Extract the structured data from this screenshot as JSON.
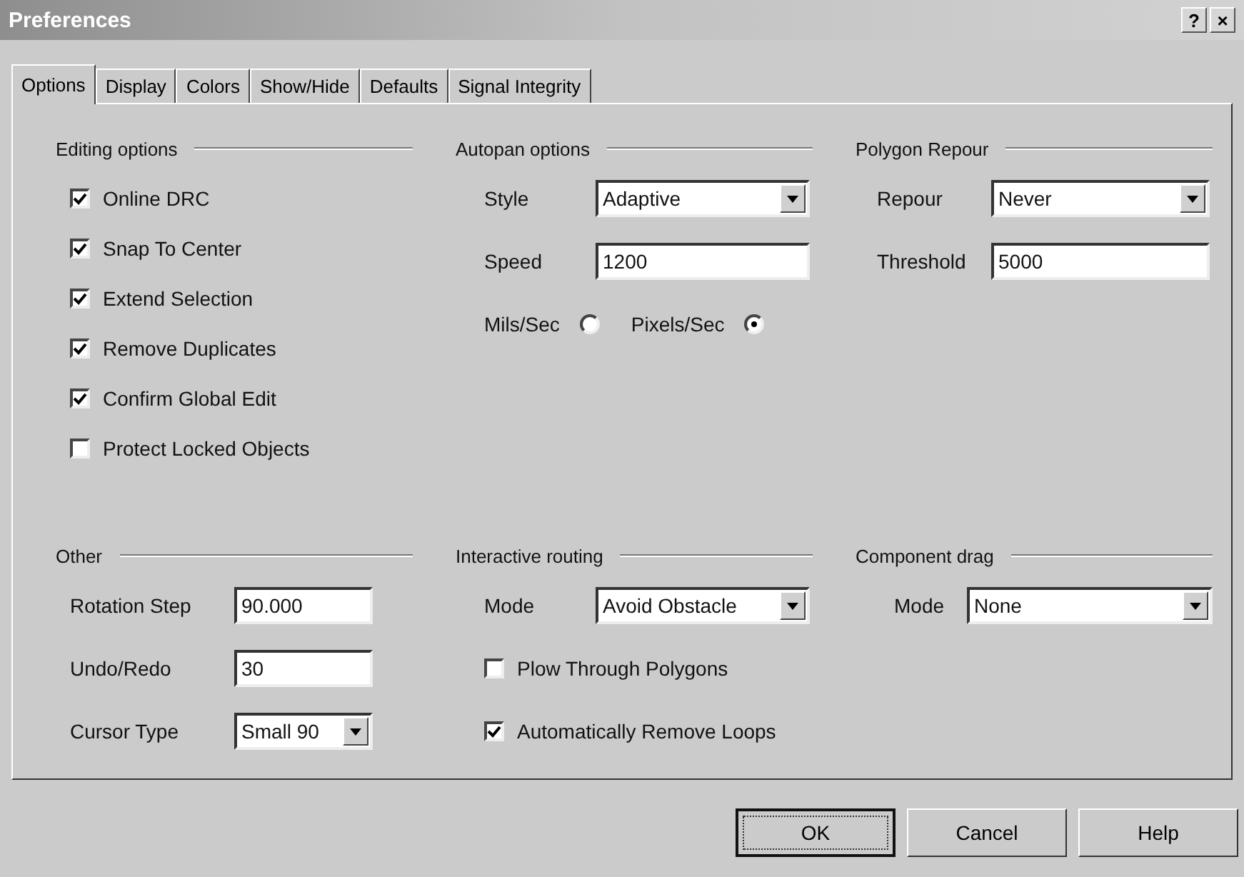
{
  "window": {
    "title": "Preferences",
    "title_buttons": [
      "?",
      "×"
    ]
  },
  "tabs": [
    {
      "label": "Options",
      "selected": true
    },
    {
      "label": "Display",
      "selected": false
    },
    {
      "label": "Colors",
      "selected": false
    },
    {
      "label": "Show/Hide",
      "selected": false
    },
    {
      "label": "Defaults",
      "selected": false
    },
    {
      "label": "Signal Integrity",
      "selected": false
    }
  ],
  "groups": [
    {
      "title": "Editing options",
      "items": [
        {
          "kind": "checkbox",
          "label": "Online DRC",
          "checked": true
        },
        {
          "kind": "checkbox",
          "label": "Snap To Center",
          "checked": true
        },
        {
          "kind": "checkbox",
          "label": "Extend Selection",
          "checked": true
        },
        {
          "kind": "checkbox",
          "label": "Remove Duplicates",
          "checked": true
        },
        {
          "kind": "checkbox",
          "label": "Confirm Global Edit",
          "checked": true
        },
        {
          "kind": "checkbox",
          "label": "Protect Locked Objects",
          "checked": false
        }
      ]
    },
    {
      "title": "Autopan options",
      "items": [
        {
          "kind": "select",
          "label": "Style",
          "value": "Adaptive"
        },
        {
          "kind": "text",
          "label": "Speed",
          "value": "1200"
        },
        {
          "kind": "radios",
          "options": [
            {
              "label": "Mils/Sec",
              "selected": false
            },
            {
              "label": "Pixels/Sec",
              "selected": true
            }
          ]
        }
      ]
    },
    {
      "title": "Polygon Repour",
      "items": [
        {
          "kind": "select",
          "label": "Repour",
          "value": "Never"
        },
        {
          "kind": "text",
          "label": "Threshold",
          "value": "5000"
        }
      ]
    },
    {
      "title": "Other",
      "items": [
        {
          "kind": "text",
          "label": "Rotation Step",
          "value": "90.000"
        },
        {
          "kind": "text",
          "label": "Undo/Redo",
          "value": "30"
        },
        {
          "kind": "select",
          "label": "Cursor Type",
          "value": "Small 90"
        }
      ]
    },
    {
      "title": "Interactive routing",
      "items": [
        {
          "kind": "select",
          "label": "Mode",
          "value": "Avoid Obstacle"
        },
        {
          "kind": "checkbox",
          "label": "Plow Through Polygons",
          "checked": false
        },
        {
          "kind": "checkbox",
          "label": "Automatically Remove Loops",
          "checked": true
        }
      ]
    },
    {
      "title": "Component drag",
      "items": [
        {
          "kind": "select",
          "label": "Mode",
          "value": "None"
        }
      ]
    }
  ],
  "buttons": [
    {
      "label": "OK",
      "default": true
    },
    {
      "label": "Cancel",
      "default": false
    },
    {
      "label": "Help",
      "default": false
    }
  ]
}
